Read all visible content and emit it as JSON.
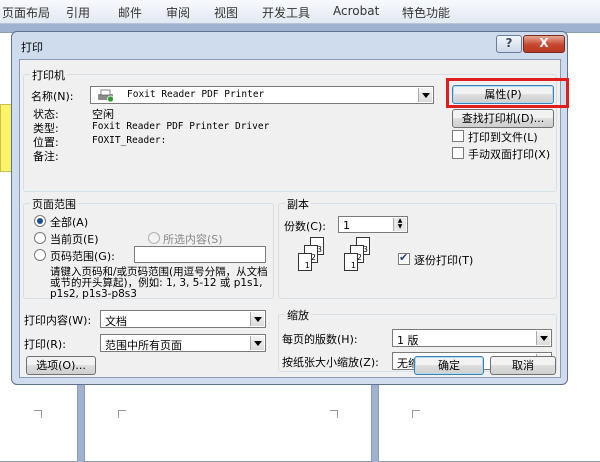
{
  "ribbon": {
    "tabs": [
      "页面布局",
      "引用",
      "邮件",
      "审阅",
      "视图",
      "开发工具",
      "Acrobat",
      "特色功能"
    ]
  },
  "dialog": {
    "title": "打印",
    "help_label": "?",
    "close_label": "X",
    "printer": {
      "group_label": "打印机",
      "name_label": "名称(N):",
      "name_value": "Foxit Reader PDF Printer",
      "properties_button": "属性(P)",
      "find_button": "查找打印机(D)...",
      "print_to_file": "打印到文件(L)",
      "manual_duplex": "手动双面打印(X)",
      "status_label": "状态:",
      "status_value": "空闲",
      "type_label": "类型:",
      "type_value": "Foxit Reader PDF Printer Driver",
      "where_label": "位置:",
      "where_value": "FOXIT_Reader:",
      "comment_label": "备注:"
    },
    "page_range": {
      "group_label": "页面范围",
      "all": "全部(A)",
      "current": "当前页(E)",
      "selection": "所选内容(S)",
      "pages": "页码范围(G):",
      "pages_value": "",
      "hint": "请键入页码和/或页码范围(用逗号分隔，从文档或节的开头算起)，例如: 1, 3, 5-12 或 p1s1, p1s2, p1s3-p8s3"
    },
    "copies": {
      "group_label": "副本",
      "count_label": "份数(C):",
      "count_value": "1",
      "collate": "逐份打印(T)",
      "sheet_numbers": [
        "3",
        "2",
        "1",
        "3",
        "2",
        "1"
      ]
    },
    "print_what_label": "打印内容(W):",
    "print_what_value": "文档",
    "print_label": "打印(R):",
    "print_value": "范围中所有页面",
    "zoom": {
      "group_label": "缩放",
      "pages_per_sheet_label": "每页的版数(H):",
      "pages_per_sheet_value": "1 版",
      "scale_label": "按纸张大小缩放(Z):",
      "scale_value": "无缩放"
    },
    "options_button": "选项(O)...",
    "ok_button": "确定",
    "cancel_button": "取消"
  },
  "colors": {
    "highlight": "#e21d1d",
    "dialog_frame": "#cfdcee",
    "close_button": "#c5462e"
  }
}
